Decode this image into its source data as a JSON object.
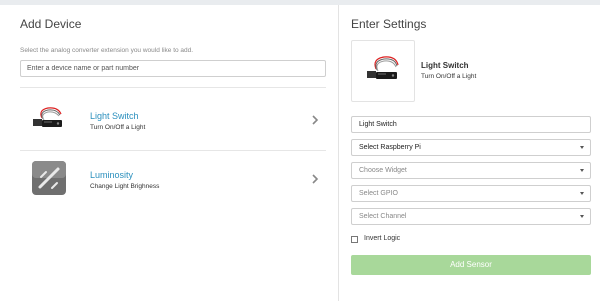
{
  "add_device": {
    "title": "Add Device",
    "helper_text": "Select the analog converter extension you would like to add.",
    "search_placeholder": "Enter a device name or part number",
    "devices": [
      {
        "name": "Light Switch",
        "description": "Turn On/Off a Light",
        "icon": "light-switch-thumbnail"
      },
      {
        "name": "Luminosity",
        "description": "Change Light Brighness",
        "icon": "luminosity-thumbnail"
      }
    ]
  },
  "settings": {
    "title": "Enter Settings",
    "selected": {
      "name": "Light Switch",
      "description": "Turn On/Off a Light"
    },
    "name_field_value": "Light Switch",
    "selects": {
      "raspberry_pi": "Select Raspberry Pi",
      "widget": "Choose Widget",
      "gpio": "Select GPIO",
      "channel": "Select Channel"
    },
    "invert_logic_label": "Invert Logic",
    "invert_logic_checked": false,
    "add_button_label": "Add Sensor",
    "colors": {
      "link": "#2a8fbd",
      "button": "#a8d89a"
    }
  }
}
